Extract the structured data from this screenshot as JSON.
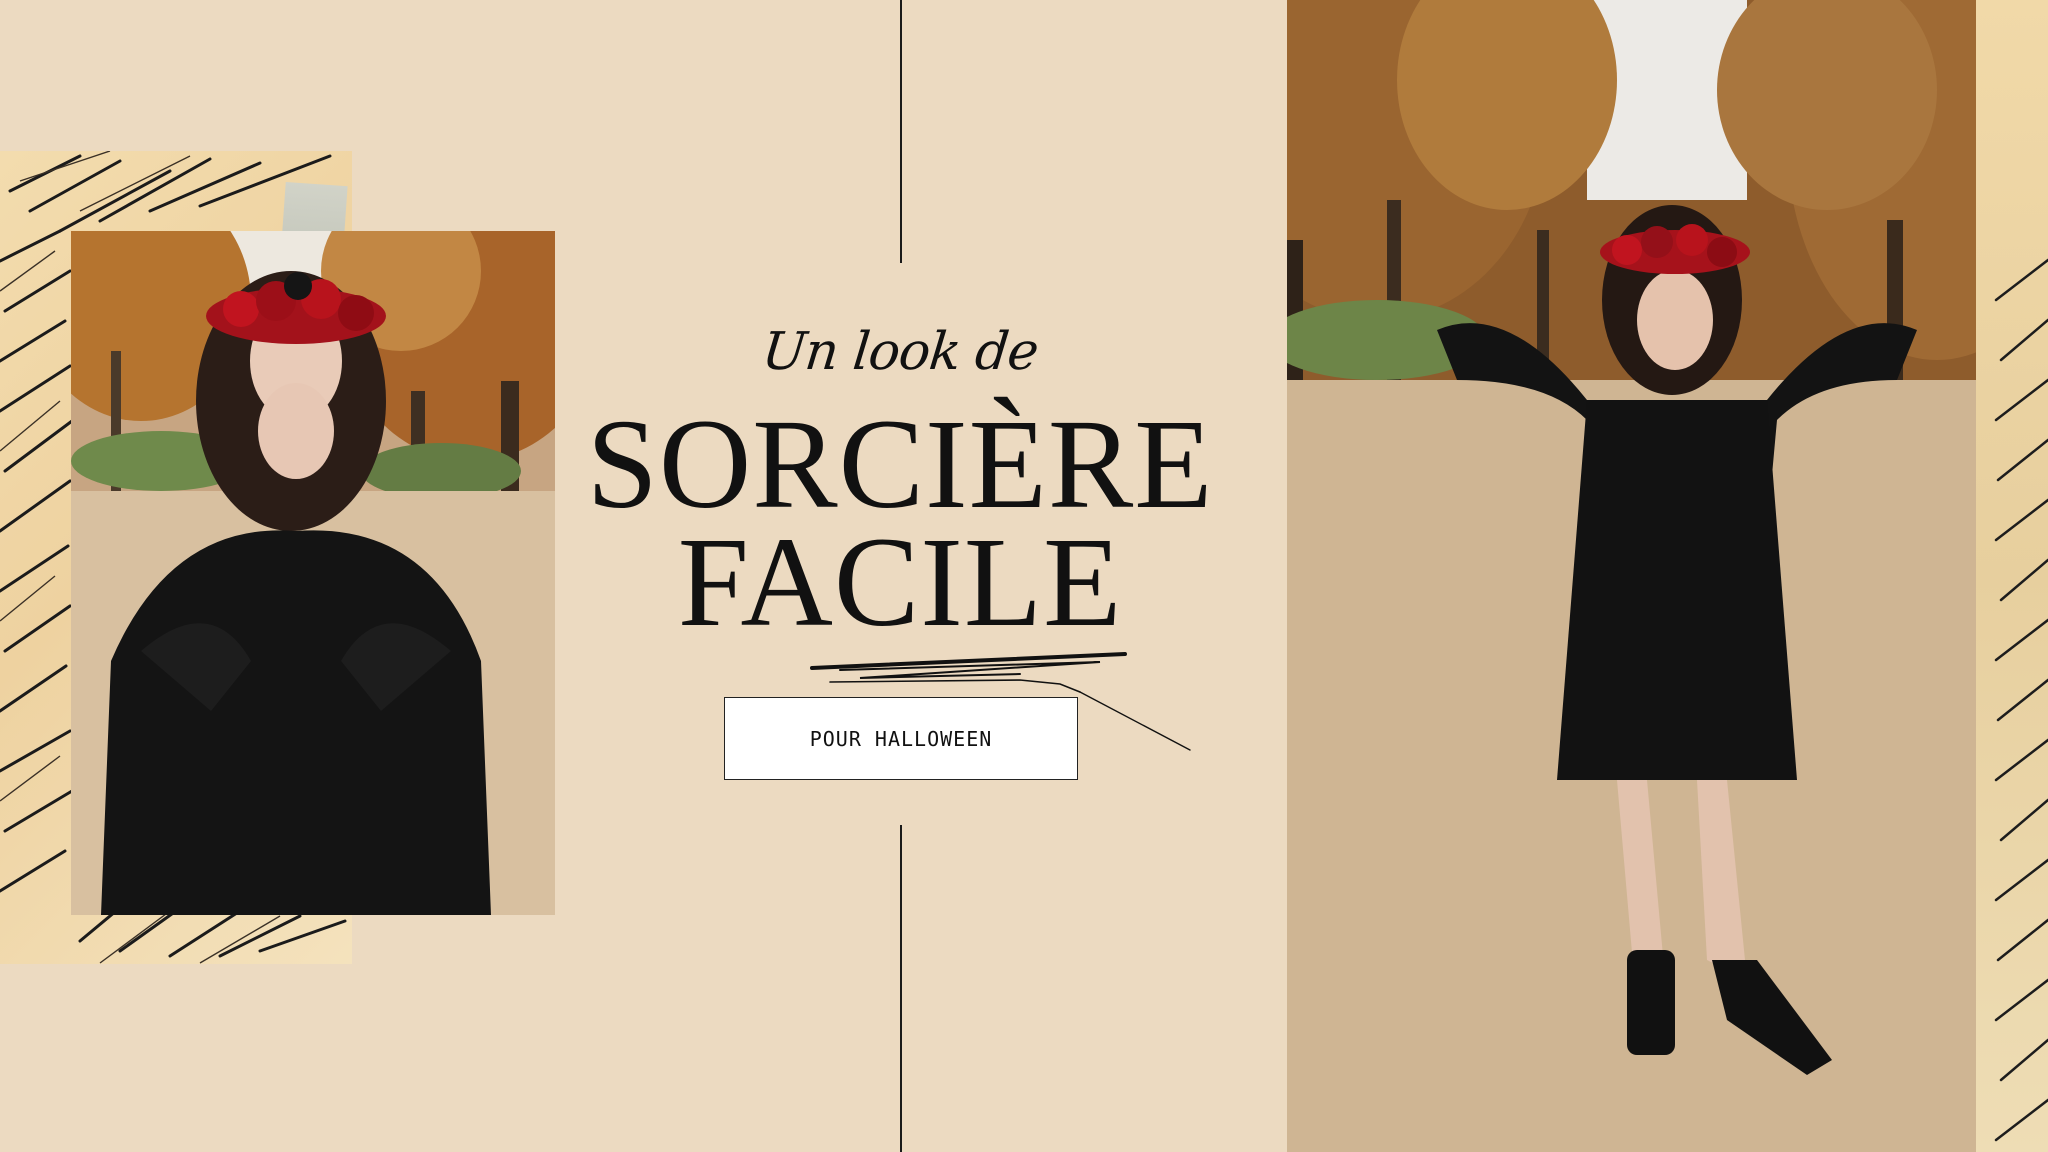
{
  "header": {
    "script_line": "Un look de",
    "title_line_1": "SORCIÈRE",
    "title_line_2": "FACILE"
  },
  "cta": {
    "label": "POUR HALLOWEEN"
  },
  "colors": {
    "background": "#ecdac1",
    "ink": "#111111",
    "box": "#ffffff",
    "autumn_leaves": "#b0702f",
    "dress": "#121212",
    "flower_crown_red": "#b3121b"
  },
  "images": {
    "left_photo": "woman-in-black-dress-with-red-flower-crown-hands-to-face",
    "right_photo": "woman-in-black-dress-crossed-legs-autumn-alley",
    "decor": "palm-leaf-collage"
  }
}
